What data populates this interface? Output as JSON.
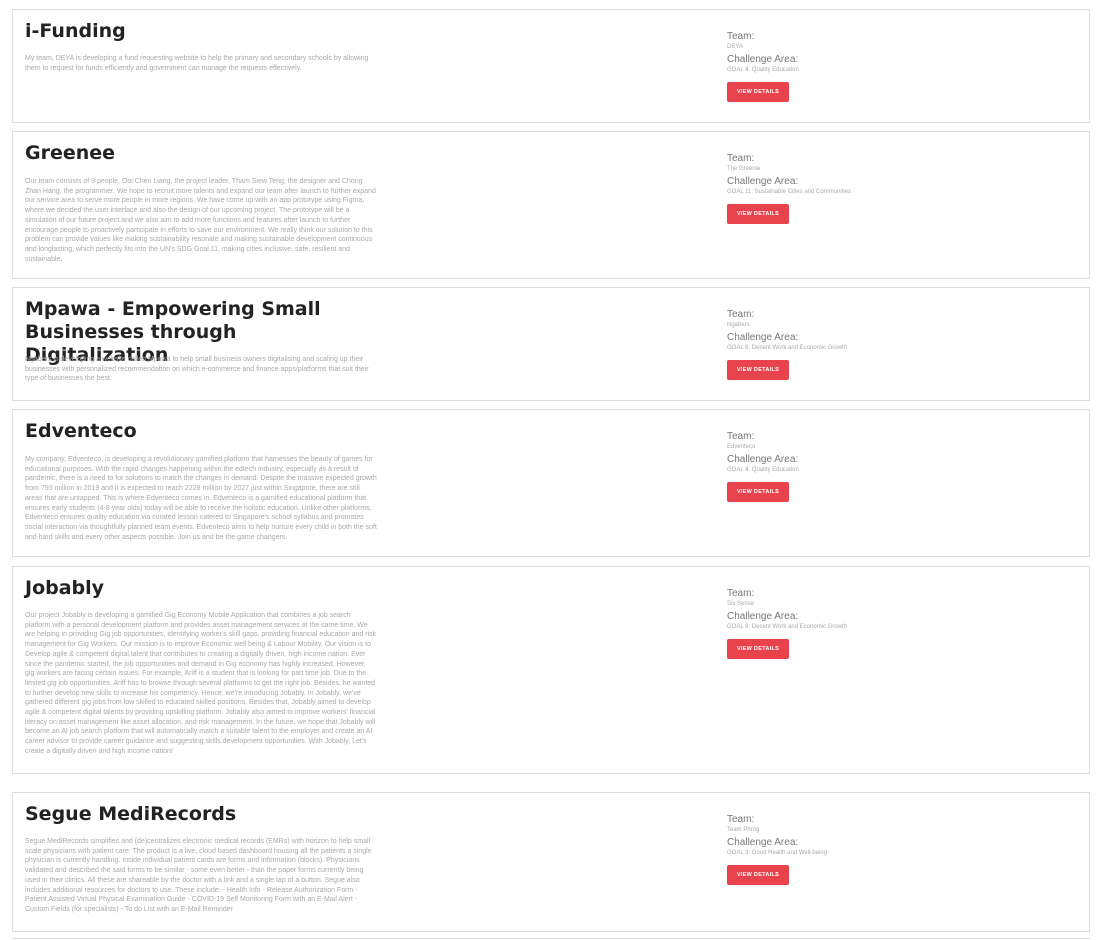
{
  "labels": {
    "team": "Team:",
    "challenge": "Challenge Area:",
    "button": "VIEW DETAILS"
  },
  "projects": [
    {
      "title": "i-Funding",
      "description": "My team, DEYA is developing a fund requesting website to help the primary and secondary schools by allowing them to request for funds efficiently and government can manage the requests effectively.",
      "team": "DEYA",
      "challenge": "GOAL 4: Quality Education"
    },
    {
      "title": "Greenee",
      "description": "Our team consists of 3 people, Ooi Chen Liang, the project leader, Tham Siew Teng, the designer and Chong Zhan Hang, the programmer. We hope to recruit more talents and expand our team after launch to further expand our service area to serve more people in more regions. We have come up with an app prototype using Figma, where we decided the user interface and also the design of our upcoming project. The prototype will be a simulation of our future project and we also aim to add more functions and features after launch to further encourage people to proactively participate in efforts to save our environment. We really think our solution to this problem can provide values like making sustainability resonate and making sustainable development continuous and longlasting, which perfectly fits into the UN's SDG Goal 11, making cities inclusive, safe, resilient and sustainable.",
      "team": "The Greenie",
      "challenge": "GOAL 11: Sustainable Cities and Communities"
    },
    {
      "title": "Mpawa - Empowering Small Businesses through Digitalization",
      "description": "Ngabers is developing a website called Mpawa to help small business owners digitalising and scaling up their businesses with personalized recommendation on which e-commerce and finance apps/platforms that suit their type of businesses the best.",
      "team": "Ngabers",
      "challenge": "GOAL 8: Decent Work and Economic Growth"
    },
    {
      "title": "Edventeco",
      "description": "My company, Edventeco, is developing a revolutionary gamified platform that harnesses the beauty of games for educational purposes. With the rapid changes happening within the edtech industry, especially as a result of pandemic, there is a need to for solutions to match the changes in demand. Despite the massive expected growth from 793 million in 2019 and it is expected to reach 2228 million by 2027 just within Singapore, there are still areas that are untapped. This is where Edventeco comes in. Edventeco is a gamified educational platform that ensures early students (4-8 year olds) today will be able to receive the holistic education. Unlike other platforms, Edventeco ensures quality education via curated lesson catered to Singapore's school syllabus and promotes social interaction via thoughtfully planned team events. Edventeco aims to help nurture every child in both the soft and hard skills and every other aspects possible. Join us and be the game changers.",
      "team": "Edventeco",
      "challenge": "GOAL 4: Quality Education"
    },
    {
      "title": "Jobably",
      "description": "Our project Jobably is developing a gamified Gig Economy Mobile Application that combines a job search platform with a personal development platform and provides asset management services at the same time. We are helping in providing Gig job opportunities, identifying worker's skill gaps, providing financial education and risk management for Gig Workers. Our mission is to improve Economic well being & Labour Mobility. Our vision is to Develop agile & competent digital talent that contributes to creating a digitally driven, high income nation. Ever since the pandemic started, the job opportunities and demand in Gig economy has highly increased. However, gig workers are facing certain issues. For example, Ariff is a student that is looking for part time job. Due to the limited gig job opportunities, Ariff has to browse through several platforms to get the right job. Besides, he wanted to further develop new skills to increase his competency. Hence, we're introducing Jobably. In Jobably, we've gathered different gig jobs from low skilled to educated skilled positions. Besides that, Jobably aimed to develop agile & competent digital talents by providing upskilling platform. Jobably also aimed to improve workers' financial literacy on asset management like asset allocation, and risk management. In the future, we hope that Jobably will become an AI job search platform that will automatically match a suitable talent to the employer and create an AI career advisor to provide career guidance and suggesting skills development opportunities. With Jobably, Let's create a digitally driven and high income nation!",
      "team": "Six Sense",
      "challenge": "GOAL 8: Decent Work and Economic Growth"
    },
    {
      "title": "Segue MediRecords",
      "description": "Segue MediRecords simplifies and (de)centralizes electronic medical records (EMRs) with horizon to help small scale physicians with patient care. The product is a live, cloud based dashboard housing all the patients a single physician is currently handling. Inside individual patient cards are forms and information (blocks). Physicians validated and described the said forms to be similar - some even better - than the paper forms currently being used in their clinics. All these are shareable by the doctor with a link and a single tap of a button. Segue also includes additional resources for doctors to use. These include: - Health Info - Release Authorization Form - Patient Assisted Virtual Physical Examination Guide - COVID-19 Self Monitoring Form with an E-Mail Alert - Custom Fields (for specialists) - To do List with an E-Mail Reminder",
      "team": "Team Phrog",
      "challenge": "GOAL 3: Good Health and Well-being"
    }
  ]
}
